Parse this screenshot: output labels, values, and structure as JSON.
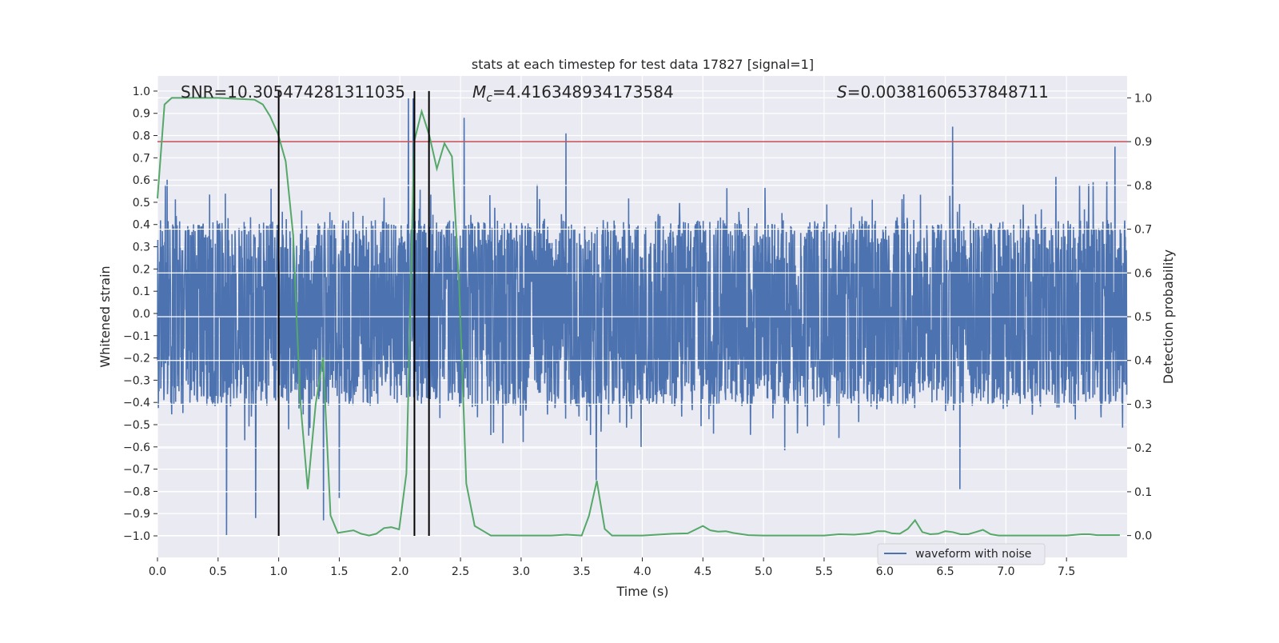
{
  "chart_data": {
    "type": "line",
    "title": "stats at each timestep for test data 17827 [signal=1]",
    "xlabel": "Time (s)",
    "ylabel_left": "Whitened strain",
    "ylabel_right": "Detection probability",
    "xlim": [
      0,
      8.0
    ],
    "ylim_left": [
      -1.097,
      1.068
    ],
    "ylim_right": [
      -0.05,
      1.05
    ],
    "x_ticks": [
      "0.0",
      "0.5",
      "1.0",
      "1.5",
      "2.0",
      "2.5",
      "3.0",
      "3.5",
      "4.0",
      "4.5",
      "5.0",
      "5.5",
      "6.0",
      "6.5",
      "7.0",
      "7.5"
    ],
    "y_left_ticks": [
      "1.0",
      "0.9",
      "0.8",
      "0.7",
      "0.6",
      "0.5",
      "0.4",
      "0.3",
      "0.2",
      "0.1",
      "0.0",
      "−0.1",
      "−0.2",
      "−0.3",
      "−0.4",
      "−0.5",
      "−0.6",
      "−0.7",
      "−0.8",
      "−0.9",
      "−1.0"
    ],
    "y_right_ticks": [
      "0.0",
      "0.1",
      "0.2",
      "0.3",
      "0.4",
      "0.5",
      "0.6",
      "0.7",
      "0.8",
      "0.9",
      "1.0"
    ],
    "grid": true,
    "background": "#eaeaf2",
    "annotations": {
      "snr": "SNR=10.305474281311035",
      "mc_symbol": "M",
      "mc_sub": "c",
      "mc_value": "=4.416348934173584",
      "s_symbol": "S",
      "s_value": "=0.00381606537848711"
    },
    "legend": {
      "placement": "lower-right",
      "entries": [
        "waveform with noise"
      ]
    },
    "series": [
      {
        "name": "waveform with noise",
        "axis": "left",
        "color": "#4c72b0",
        "description_kind": "dense noise band",
        "typical_range": [
          -0.42,
          0.42
        ],
        "notable_peaks": [
          [
            0.57,
            -1.0
          ],
          [
            0.81,
            -0.92
          ],
          [
            1.37,
            -0.93
          ],
          [
            1.5,
            -0.83
          ],
          [
            2.07,
            0.97
          ],
          [
            2.11,
            0.97
          ],
          [
            2.53,
            0.88
          ],
          [
            3.37,
            0.81
          ],
          [
            3.62,
            -0.75
          ],
          [
            6.56,
            0.84
          ],
          [
            6.62,
            -0.79
          ],
          [
            7.9,
            0.75
          ]
        ]
      },
      {
        "axis": "right",
        "color": "#55a868",
        "points": [
          [
            0,
            0.77
          ],
          [
            0.058,
            0.985
          ],
          [
            0.118,
            1.0
          ],
          [
            0.5,
            1.0
          ],
          [
            0.8,
            0.996
          ],
          [
            0.869,
            0.985
          ],
          [
            0.929,
            0.958
          ],
          [
            0.994,
            0.918
          ],
          [
            1.058,
            0.855
          ],
          [
            1.12,
            0.685
          ],
          [
            1.176,
            0.315
          ],
          [
            1.24,
            0.106
          ],
          [
            1.305,
            0.3
          ],
          [
            1.366,
            0.407
          ],
          [
            1.428,
            0.046
          ],
          [
            1.488,
            0.006
          ],
          [
            1.553,
            0.009
          ],
          [
            1.617,
            0.012
          ],
          [
            1.68,
            0.004
          ],
          [
            1.746,
            0.0
          ],
          [
            1.806,
            0.004
          ],
          [
            1.869,
            0.017
          ],
          [
            1.929,
            0.019
          ],
          [
            1.994,
            0.014
          ],
          [
            2.054,
            0.142
          ],
          [
            2.118,
            0.9
          ],
          [
            2.18,
            0.969
          ],
          [
            2.243,
            0.914
          ],
          [
            2.305,
            0.838
          ],
          [
            2.368,
            0.896
          ],
          [
            2.43,
            0.866
          ],
          [
            2.488,
            0.58
          ],
          [
            2.548,
            0.119
          ],
          [
            2.617,
            0.022
          ],
          [
            2.69,
            0.01
          ],
          [
            2.75,
            0.0
          ],
          [
            3.0,
            0.0
          ],
          [
            3.25,
            0.0
          ],
          [
            3.375,
            0.002
          ],
          [
            3.5,
            0.0
          ],
          [
            3.56,
            0.045
          ],
          [
            3.625,
            0.125
          ],
          [
            3.69,
            0.015
          ],
          [
            3.75,
            0.0
          ],
          [
            4.0,
            0.0
          ],
          [
            4.25,
            0.004
          ],
          [
            4.375,
            0.005
          ],
          [
            4.5,
            0.022
          ],
          [
            4.56,
            0.012
          ],
          [
            4.625,
            0.009
          ],
          [
            4.69,
            0.01
          ],
          [
            4.75,
            0.006
          ],
          [
            4.875,
            0.001
          ],
          [
            5.0,
            0.0
          ],
          [
            5.5,
            0.0
          ],
          [
            5.625,
            0.003
          ],
          [
            5.75,
            0.002
          ],
          [
            5.875,
            0.005
          ],
          [
            5.94,
            0.01
          ],
          [
            6.0,
            0.01
          ],
          [
            6.06,
            0.005
          ],
          [
            6.125,
            0.004
          ],
          [
            6.19,
            0.015
          ],
          [
            6.25,
            0.035
          ],
          [
            6.31,
            0.008
          ],
          [
            6.375,
            0.003
          ],
          [
            6.44,
            0.004
          ],
          [
            6.5,
            0.01
          ],
          [
            6.56,
            0.008
          ],
          [
            6.625,
            0.003
          ],
          [
            6.69,
            0.003
          ],
          [
            6.75,
            0.008
          ],
          [
            6.81,
            0.013
          ],
          [
            6.875,
            0.003
          ],
          [
            6.94,
            0.0
          ],
          [
            7.5,
            0.0
          ],
          [
            7.625,
            0.003
          ],
          [
            7.69,
            0.003
          ],
          [
            7.75,
            0.001
          ],
          [
            7.94,
            0.001
          ]
        ]
      }
    ],
    "threshold_line": {
      "axis": "right",
      "value": 0.9,
      "color": "#c44e52"
    },
    "vertical_lines": {
      "values": [
        1.0,
        2.12,
        2.24
      ],
      "color": "#000000"
    }
  }
}
